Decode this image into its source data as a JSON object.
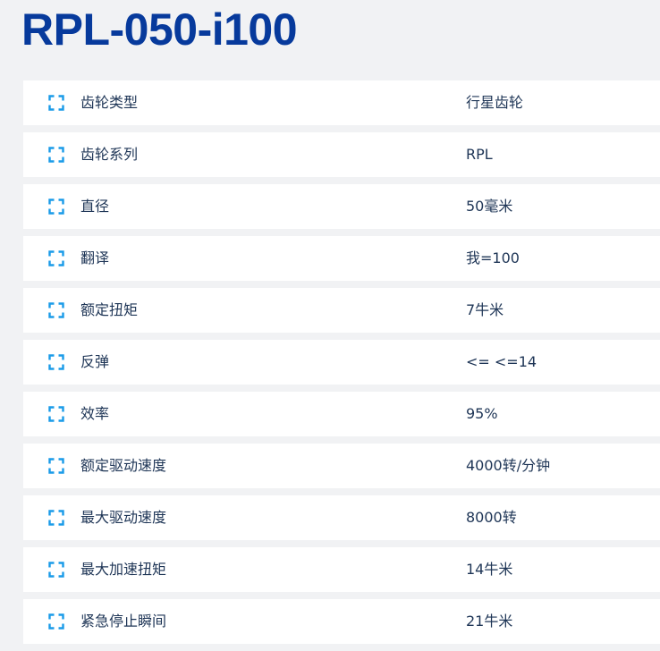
{
  "page": {
    "title": "RPL-050-i100"
  },
  "colors": {
    "title": "#073a9c",
    "icon": "#1a9be8",
    "text": "#1e3556",
    "row_background": "#ffffff",
    "page_background": "#f1f2f4"
  },
  "spec_icon": "expand-corners-icon",
  "specs": [
    {
      "label": "齿轮类型",
      "value": "行星齿轮"
    },
    {
      "label": "齿轮系列",
      "value": "RPL"
    },
    {
      "label": "直径",
      "value": "50毫米"
    },
    {
      "label": "翻译",
      "value": "我=100"
    },
    {
      "label": "额定扭矩",
      "value": "7牛米"
    },
    {
      "label": "反弹",
      "value": "<= <=14"
    },
    {
      "label": "效率",
      "value": "95%"
    },
    {
      "label": "额定驱动速度",
      "value": "4000转/分钟"
    },
    {
      "label": "最大驱动速度",
      "value": "8000转"
    },
    {
      "label": "最大加速扭矩",
      "value": "14牛米"
    },
    {
      "label": "紧急停止瞬间",
      "value": "21牛米"
    }
  ]
}
